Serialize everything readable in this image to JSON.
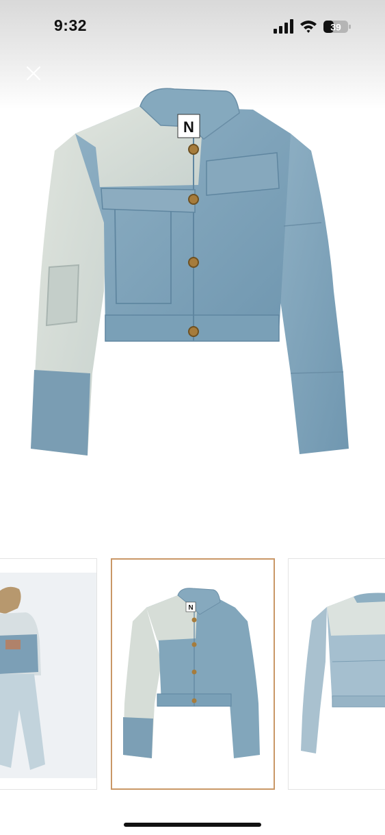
{
  "status_bar": {
    "time": "9:32",
    "battery_level": "39",
    "icons": [
      "signal-bars-icon",
      "wifi-icon",
      "battery-icon"
    ]
  },
  "viewer": {
    "close_icon": "close-icon",
    "main_image": {
      "logo_letter": "N"
    },
    "thumbnails": [
      {
        "name": "model-back-view",
        "selected": false
      },
      {
        "name": "jacket-front-view",
        "selected": true,
        "logo_letter": "N"
      },
      {
        "name": "jacket-back-view",
        "selected": false
      }
    ]
  },
  "colors": {
    "selected_border": "#c99766",
    "denim_mid": "#7ea2b8",
    "denim_light": "#d5dcd6",
    "denim_dark": "#6a91aa"
  }
}
